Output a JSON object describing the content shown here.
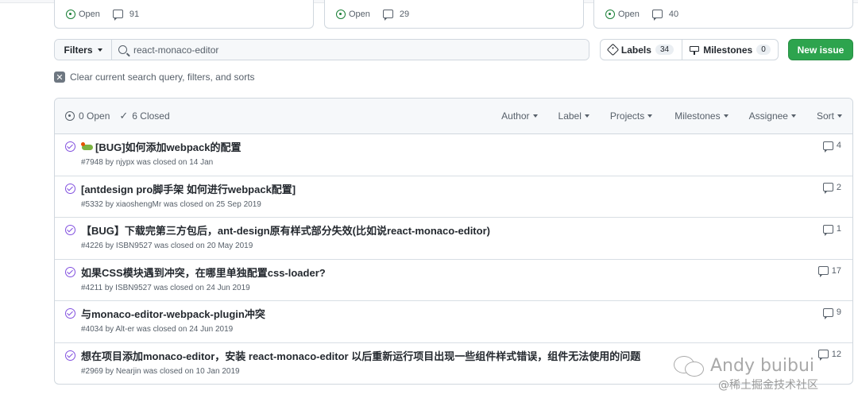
{
  "top_cards": [
    {
      "state": "Open",
      "comments": "91"
    },
    {
      "state": "Open",
      "comments": "29"
    },
    {
      "state": "Open",
      "comments": "40"
    }
  ],
  "toolbar": {
    "filters_label": "Filters",
    "search_value": "react-monaco-editor",
    "labels_label": "Labels",
    "labels_count": "34",
    "milestones_label": "Milestones",
    "milestones_count": "0",
    "new_issue_label": "New issue",
    "clear_label": "Clear current search query, filters, and sorts"
  },
  "issues_header": {
    "open_label": "0 Open",
    "closed_label": "6 Closed",
    "filters": [
      "Author",
      "Label",
      "Projects",
      "Milestones",
      "Assignee",
      "Sort"
    ]
  },
  "issues": [
    {
      "title": "[BUG]如何添加webpack的配置",
      "meta": "#7948 by njypx was closed on 14 Jan",
      "comments": "4",
      "emoji": true
    },
    {
      "title": "[antdesign pro脚手架 如何进行webpack配置]",
      "meta": "#5332 by xiaoshengMr was closed on 25 Sep 2019",
      "comments": "2",
      "emoji": false
    },
    {
      "title": "【BUG】下载完第三方包后，ant-design原有样式部分失效(比如说react-monaco-editor)",
      "meta": "#4226 by ISBN9527 was closed on 20 May 2019",
      "comments": "1",
      "emoji": false
    },
    {
      "title": "如果CSS模块遇到冲突，在哪里单独配置css-loader?",
      "meta": "#4211 by ISBN9527 was closed on 24 Jun 2019",
      "comments": "17",
      "emoji": false
    },
    {
      "title": "与monaco-editor-webpack-plugin冲突",
      "meta": "#4034 by Alt-er was closed on 24 Jun 2019",
      "comments": "9",
      "emoji": false
    },
    {
      "title": "想在项目添加monaco-editor，安装 react-monaco-editor 以后重新运行项目出现一些组件样式错误，组件无法使用的问题",
      "meta": "#2969 by Nearjin was closed on 10 Jan 2019",
      "comments": "12",
      "emoji": false
    }
  ],
  "watermark": {
    "name": "Andy buibui",
    "source": "@稀土掘金技术社区"
  },
  "colors": {
    "primary_button": "#2da44e",
    "closed_icon": "#8250df",
    "open_icon": "#1a7f37"
  }
}
